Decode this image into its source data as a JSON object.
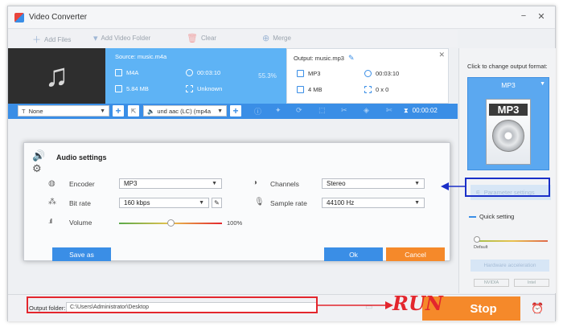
{
  "window": {
    "title": "Video Converter",
    "controls": [
      "−",
      "✕"
    ]
  },
  "toolbar": {
    "add_files": "Add Files",
    "add_video_folder": "Add Video Folder",
    "clear": "Clear",
    "merge": "Merge"
  },
  "source": {
    "label": "Source: music.m4a",
    "format": "M4A",
    "duration": "00:03:10",
    "size": "5.84 MB",
    "resolution": "Unknown"
  },
  "progress": {
    "percent": "55.3%"
  },
  "output": {
    "label": "Output: music.mp3",
    "format": "MP3",
    "duration": "00:03:10",
    "size": "4 MB",
    "resolution": "0 x 0"
  },
  "editbar": {
    "subtitle": "None",
    "audio_track": "und aac (LC) (mp4a",
    "time": "00:00:02"
  },
  "right_panel": {
    "hint": "Click to change output format:",
    "format": "MP3",
    "icon_label": "MP3",
    "param_settings": "Parameter settings",
    "quick_setting": "Quick setting",
    "quality_default": "Default",
    "hw_accel": "Hardware acceleration",
    "nvidia": "NVIDIA",
    "intel": "Intel"
  },
  "dialog": {
    "title": "Audio settings",
    "encoder_label": "Encoder",
    "encoder_value": "MP3",
    "bitrate_label": "Bit rate",
    "bitrate_value": "160 kbps",
    "volume_label": "Volume",
    "volume_value": "100%",
    "volume_level": 0.5,
    "channels_label": "Channels",
    "channels_value": "Stereo",
    "samplerate_label": "Sample rate",
    "samplerate_value": "44100 Hz",
    "save_as": "Save as",
    "ok": "Ok",
    "cancel": "Cancel"
  },
  "bottom": {
    "output_folder_label": "Output folder:",
    "output_folder_value": "C:\\Users\\Administrator\\Desktop",
    "run_annotation": "RUN",
    "stop": "Stop"
  },
  "colors": {
    "accent": "#3a8ee6",
    "orange": "#f5892a",
    "annotation": "#e3262d",
    "highlight": "#1a2fc8"
  }
}
